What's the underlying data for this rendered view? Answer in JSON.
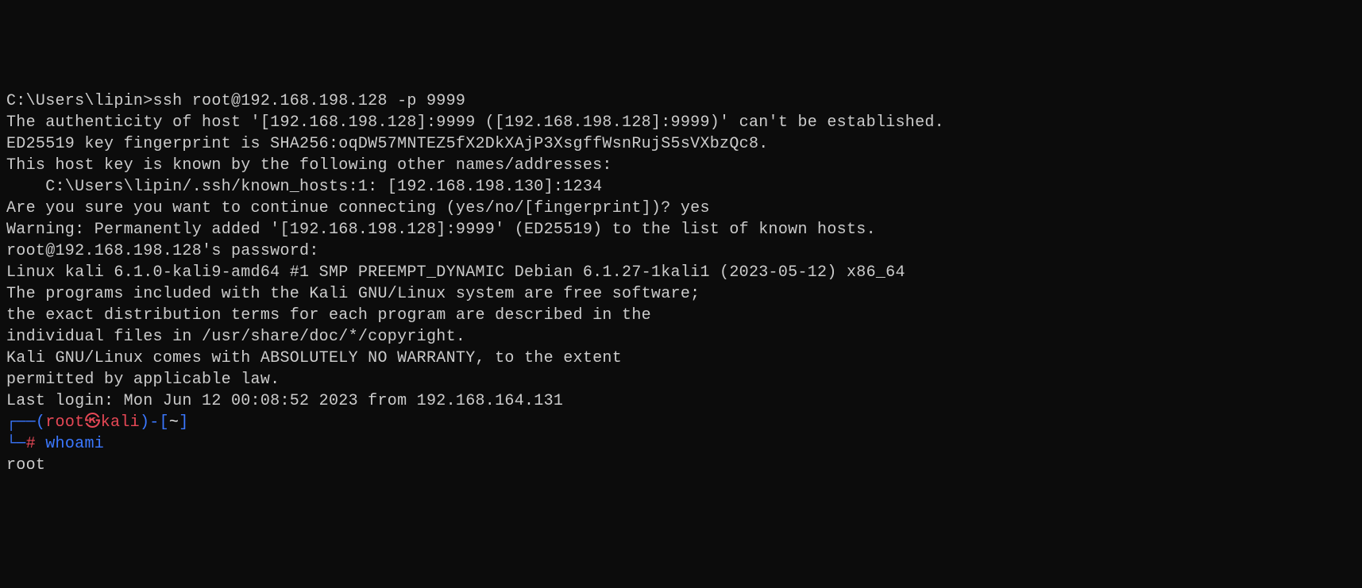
{
  "lines": {
    "l0_prompt": "C:\\Users\\lipin>",
    "l0_cmd": "ssh root@192.168.198.128 -p 9999",
    "l1": "The authenticity of host '[192.168.198.128]:9999 ([192.168.198.128]:9999)' can't be established.",
    "l2": "ED25519 key fingerprint is SHA256:oqDW57MNTEZ5fX2DkXAjP3XsgffWsnRujS5sVXbzQc8.",
    "l3": "This host key is known by the following other names/addresses:",
    "l4": "    C:\\Users\\lipin/.ssh/known_hosts:1: [192.168.198.130]:1234",
    "l5": "Are you sure you want to continue connecting (yes/no/[fingerprint])? yes",
    "l6": "Warning: Permanently added '[192.168.198.128]:9999' (ED25519) to the list of known hosts.",
    "l7": "root@192.168.198.128's password:",
    "l8": "Linux kali 6.1.0-kali9-amd64 #1 SMP PREEMPT_DYNAMIC Debian 6.1.27-1kali1 (2023-05-12) x86_64",
    "l9": "",
    "l10": "The programs included with the Kali GNU/Linux system are free software;",
    "l11": "the exact distribution terms for each program are described in the",
    "l12": "individual files in /usr/share/doc/*/copyright.",
    "l13": "",
    "l14": "Kali GNU/Linux comes with ABSOLUTELY NO WARRANTY, to the extent",
    "l15": "permitted by applicable law.",
    "l16": "Last login: Mon Jun 12 00:08:52 2023 from 192.168.164.131",
    "kali_prompt": {
      "corner_top": "┌──(",
      "user": "root",
      "skull": "㉿",
      "host": "kali",
      "close_paren": ")",
      "dash": "-",
      "bracket_open": "[",
      "cwd": "~",
      "bracket_close": "]",
      "corner_bottom": "└─",
      "hash": "#",
      "space": " ",
      "cmd": "whoami"
    },
    "l19": "root"
  }
}
